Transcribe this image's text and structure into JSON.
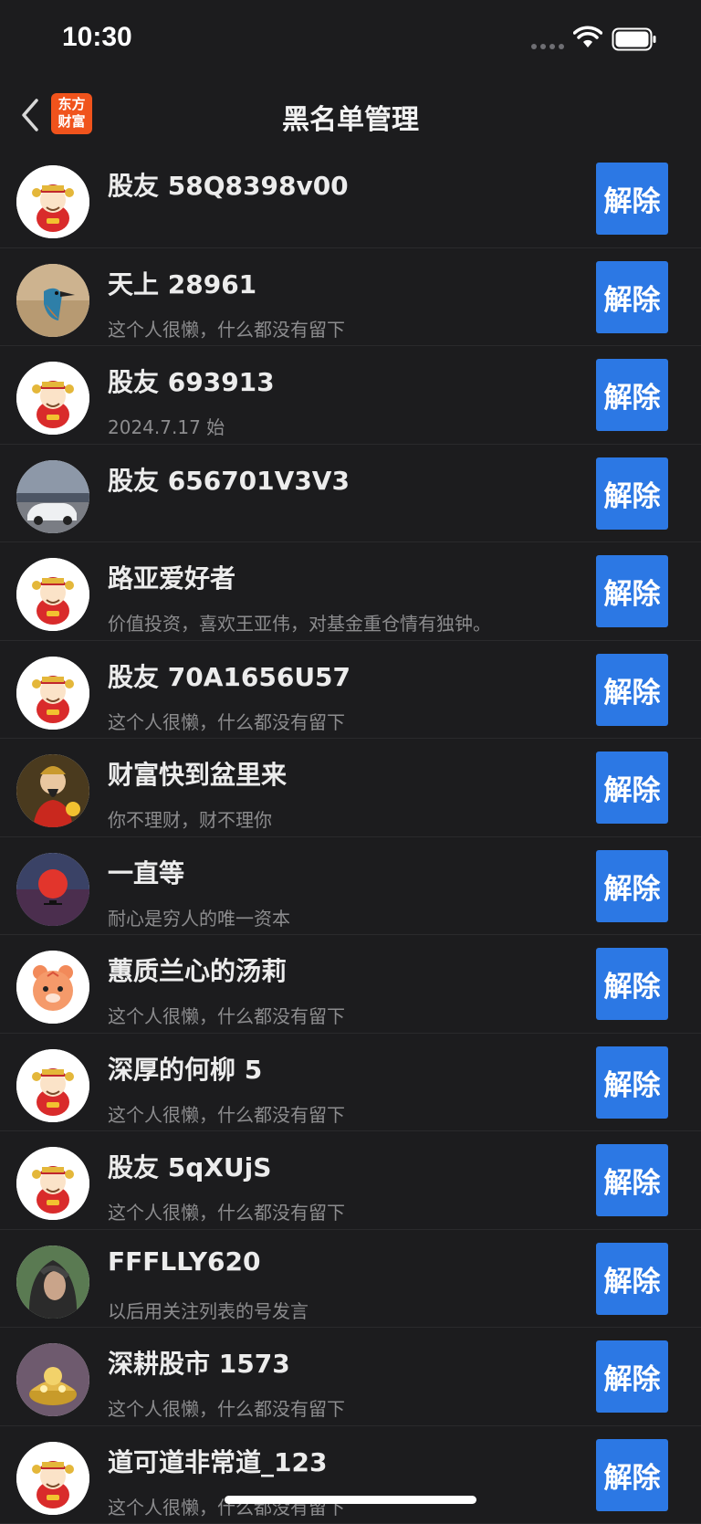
{
  "status_bar": {
    "time": "10:30"
  },
  "nav": {
    "title": "黑名单管理",
    "logo_text_line1": "东方",
    "logo_text_line2": "财富"
  },
  "list": [
    {
      "name": "股友 58Q8398v00",
      "subtitle": "",
      "avatar": "mascot-avatar",
      "button": "解除"
    },
    {
      "name": "天上 28961",
      "subtitle": "这个人很懒，什么都没有留下",
      "avatar": "kingfisher-avatar",
      "button": "解除"
    },
    {
      "name": "股友 693913",
      "subtitle": "2024.7.17 始",
      "avatar": "mascot-avatar",
      "button": "解除"
    },
    {
      "name": "股友 656701V3V3",
      "subtitle": "",
      "avatar": "car-photo-avatar",
      "button": "解除"
    },
    {
      "name": "路亚爱好者",
      "subtitle": "价值投资，喜欢王亚伟，对基金重仓情有独钟。",
      "avatar": "mascot-avatar",
      "button": "解除"
    },
    {
      "name": "股友 70A1656U57",
      "subtitle": "这个人很懒，什么都没有留下",
      "avatar": "mascot-avatar",
      "button": "解除"
    },
    {
      "name": "财富快到盆里来",
      "subtitle": "你不理财，财不理你",
      "avatar": "god-of-wealth-avatar",
      "button": "解除"
    },
    {
      "name": "一直等",
      "subtitle": "耐心是穷人的唯一资本",
      "avatar": "sunset-avatar",
      "button": "解除"
    },
    {
      "name": "蕙质兰心的汤莉",
      "subtitle": "这个人很懒，什么都没有留下",
      "avatar": "tiger-avatar",
      "button": "解除"
    },
    {
      "name": "深厚的何柳 5",
      "subtitle": "这个人很懒，什么都没有留下",
      "avatar": "mascot-avatar",
      "button": "解除"
    },
    {
      "name": "股友 5qXUjS",
      "subtitle": "这个人很懒，什么都没有留下",
      "avatar": "mascot-avatar",
      "button": "解除"
    },
    {
      "name": "FFFLLY620",
      "subtitle": "以后用关注列表的号发言",
      "avatar": "portrait-photo-avatar",
      "button": "解除"
    },
    {
      "name": "深耕股市 1573",
      "subtitle": "这个人很懒，什么都没有留下",
      "avatar": "gold-treasure-avatar",
      "button": "解除"
    },
    {
      "name": "道可道非常道_123",
      "subtitle": "这个人很懒，什么都没有留下",
      "avatar": "mascot-avatar",
      "button": "解除"
    }
  ],
  "colors": {
    "background": "#1c1c1e",
    "button": "#2c78e4",
    "logo": "#f0531c"
  }
}
